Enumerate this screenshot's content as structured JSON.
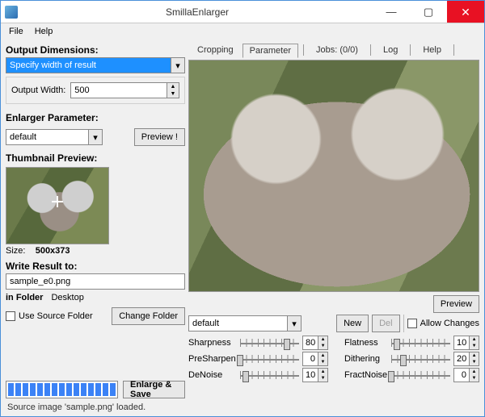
{
  "window": {
    "title": "SmillaEnlarger"
  },
  "menubar": {
    "file": "File",
    "help": "Help"
  },
  "left": {
    "output_dim_title": "Output Dimensions:",
    "dim_combo": "Specify width of result",
    "output_width_label": "Output Width:",
    "output_width_value": "500",
    "enlarger_param_title": "Enlarger Parameter:",
    "enlarger_combo": "default",
    "preview_btn": "Preview !",
    "thumb_title": "Thumbnail Preview:",
    "size_label": "Size:",
    "size_value": "500x373",
    "write_result_title": "Write Result to:",
    "filename": "sample_e0.png",
    "in_folder_label": "in Folder",
    "folder_value": "Desktop",
    "use_source_folder_label": "Use Source Folder",
    "change_folder_btn": "Change Folder",
    "enlarge_save_btn": "Enlarge & Save"
  },
  "tabs": {
    "cropping": "Cropping",
    "parameter": "Parameter",
    "jobs": "Jobs: (0/0)",
    "log": "Log",
    "help": "Help"
  },
  "controls": {
    "preview_btn": "Preview",
    "preset": "default",
    "new_btn": "New",
    "del_btn": "Del",
    "allow_changes_label": "Allow Changes",
    "params": {
      "sharpness": {
        "label": "Sharpness",
        "value": "80",
        "pos": 80
      },
      "presharpen": {
        "label": "PreSharpen",
        "value": "0",
        "pos": 0
      },
      "denoise": {
        "label": "DeNoise",
        "value": "10",
        "pos": 10
      },
      "flatness": {
        "label": "Flatness",
        "value": "10",
        "pos": 10
      },
      "dithering": {
        "label": "Dithering",
        "value": "20",
        "pos": 20
      },
      "fractnoise": {
        "label": "FractNoise",
        "value": "0",
        "pos": 0
      }
    }
  },
  "status": "Source image 'sample.png' loaded."
}
